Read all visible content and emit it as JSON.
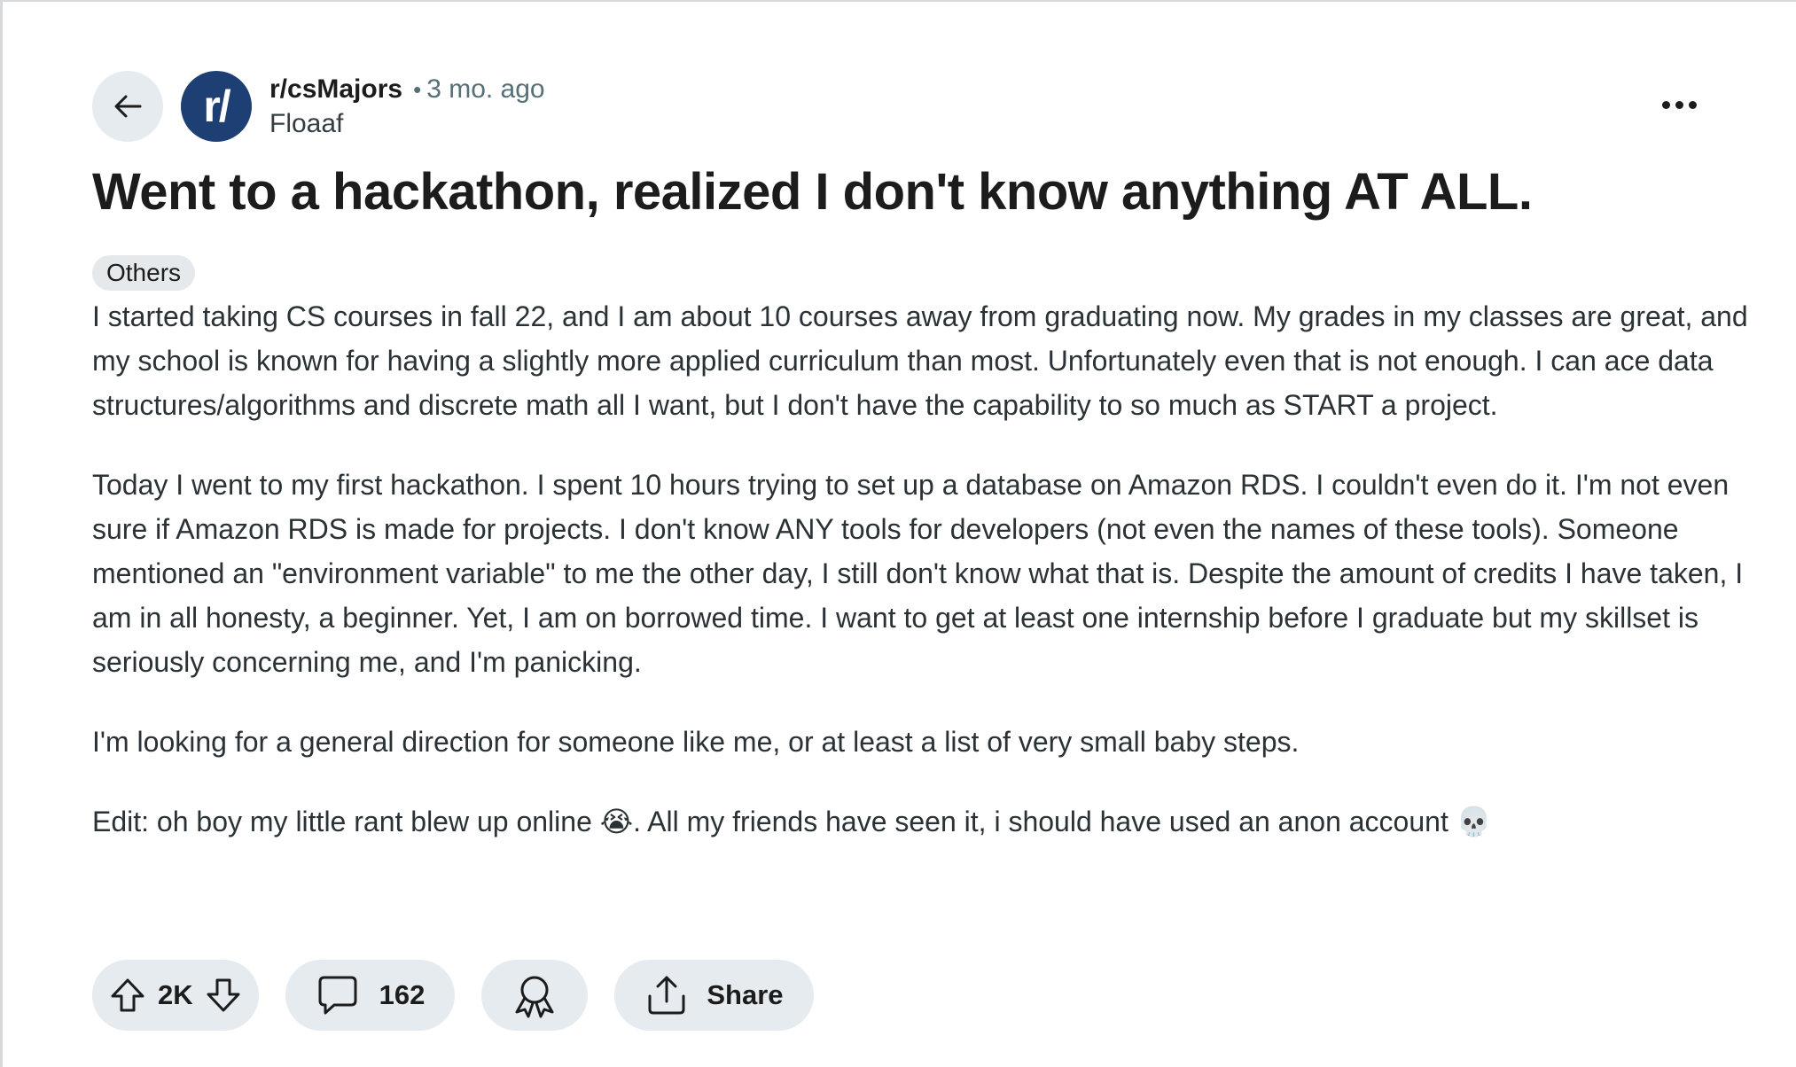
{
  "post": {
    "subreddit": "r/csMajors",
    "subreddit_avatar_text": "r/",
    "separator": "•",
    "time_ago": "3 mo. ago",
    "author": "Floaaf",
    "title": "Went to a hackathon, realized I don't know anything AT ALL.",
    "flair": "Others",
    "paragraphs": [
      "I started taking CS courses in fall 22, and I am about 10 courses away from graduating now. My grades in my classes are great, and my school is known for having a slightly more applied curriculum than most. Unfortunately even that is not enough. I can ace data structures/algorithms and discrete math all I want, but I don't have the capability to so much as START a project.",
      "Today I went to my first hackathon. I spent 10 hours trying to set up a database on Amazon RDS. I couldn't even do it. I'm not even sure if Amazon RDS is made for projects. I don't know ANY tools for developers (not even the names of these tools). Someone mentioned an \"environment variable\" to me the other day, I still don't know what that is. Despite the amount of credits I have taken, I am in all honesty, a beginner. Yet, I am on borrowed time. I want to get at least one internship before I graduate but my skillset is seriously concerning me, and I'm panicking.",
      "I'm looking for a general direction for someone like me, or at least a list of very small baby steps.",
      "Edit: oh boy my little rant blew up online 😭. All my friends have seen it, i should have used an anon account 💀"
    ]
  },
  "actions": {
    "vote_count": "2K",
    "comment_count": "162",
    "share_label": "Share"
  },
  "colors": {
    "subreddit_avatar": "#1e3f74",
    "pill_background": "#e5ebee",
    "flair_background": "#e5e9eb"
  },
  "icons": {
    "back": "arrow-left-icon",
    "more": "more-horizontal-icon",
    "upvote": "upvote-arrow-icon",
    "downvote": "downvote-arrow-icon",
    "comment": "comment-bubble-icon",
    "award": "award-ribbon-icon",
    "share": "share-upload-icon"
  }
}
